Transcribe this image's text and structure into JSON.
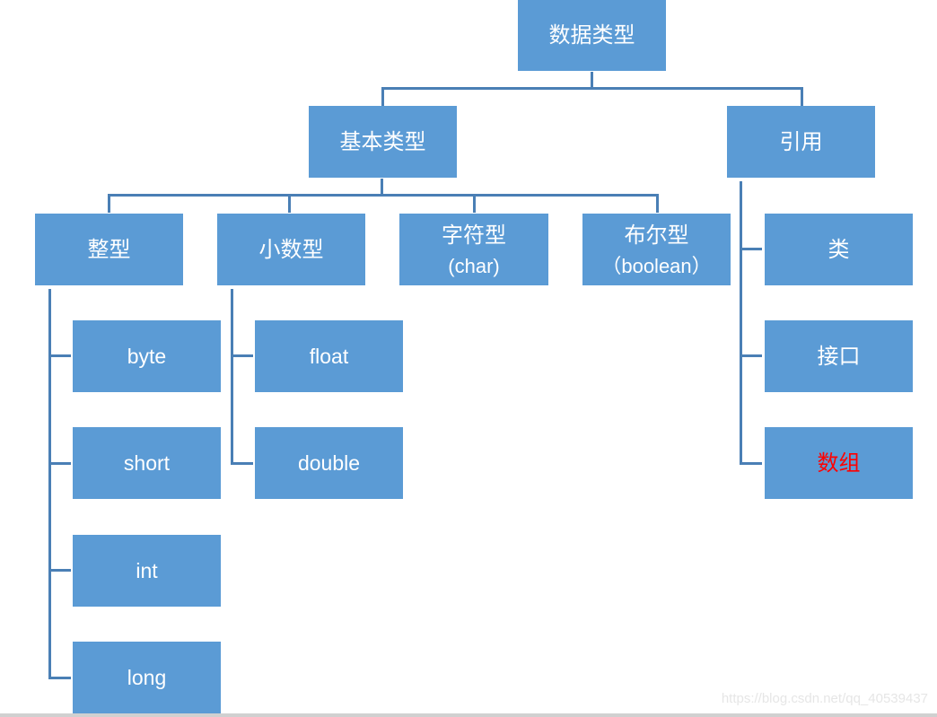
{
  "diagram": {
    "root": "数据类型",
    "basic": {
      "label": "基本类型",
      "integer": {
        "label": "整型",
        "children": [
          "byte",
          "short",
          "int",
          "long"
        ]
      },
      "decimal": {
        "label": "小数型",
        "children": [
          "float",
          "double"
        ]
      },
      "char": {
        "label": "字符型",
        "sub": "(char)"
      },
      "boolean": {
        "label": "布尔型",
        "sub": "（boolean）"
      }
    },
    "reference": {
      "label": "引用",
      "children": [
        "类",
        "接口",
        "数组"
      ],
      "highlight_color": "#ff0000"
    },
    "node_color": "#5b9bd5",
    "line_color": "#4a7fb5"
  },
  "watermark": "https://blog.csdn.net/qq_40539437"
}
